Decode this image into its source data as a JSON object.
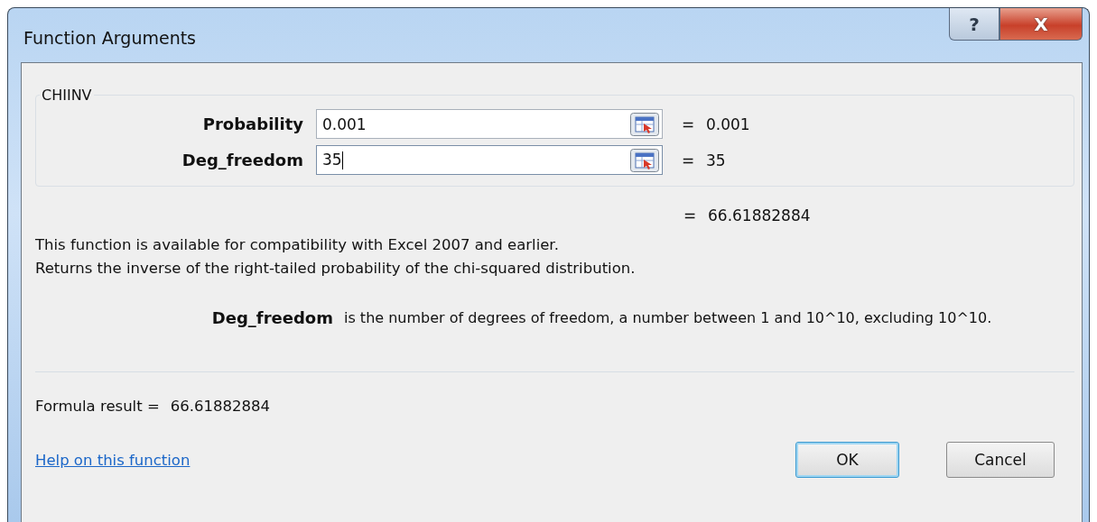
{
  "window": {
    "title": "Function Arguments"
  },
  "title_buttons": [
    {
      "kind": "help",
      "label": "?"
    },
    {
      "kind": "close",
      "label": "X"
    }
  ],
  "function_name": "CHIINV",
  "arguments": [
    {
      "label": "Probability",
      "value": "0.001",
      "result": "0.001",
      "focused": false
    },
    {
      "label": "Deg_freedom",
      "value": "35",
      "result": "35",
      "focused": true
    }
  ],
  "equals": "=",
  "function_result": "66.61882884",
  "description": [
    "This function is available for compatibility with Excel 2007 and earlier.",
    "Returns the inverse of the right-tailed probability of the chi-squared distribution."
  ],
  "argument_help": {
    "name": "Deg_freedom",
    "text": "is the number of degrees of freedom, a number between 1 and 10^10, excluding 10^10."
  },
  "formula_result": {
    "label": "Formula result =",
    "value": "66.61882884"
  },
  "help_link": "Help on this function",
  "buttons": [
    {
      "label": "OK",
      "default": true
    },
    {
      "label": "Cancel",
      "default": false
    }
  ]
}
